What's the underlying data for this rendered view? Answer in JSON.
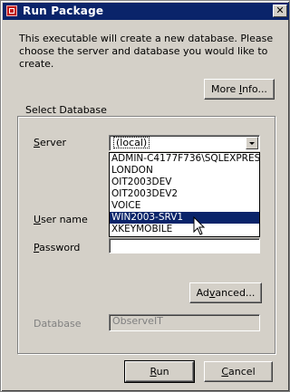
{
  "window": {
    "title": "Run Package",
    "close_glyph": "✕"
  },
  "intro_text": "This executable will create a new database. Please choose the server and database you would like to create.",
  "more_info_button": {
    "label_prefix": "More ",
    "label_mnemonic": "I",
    "label_suffix": "nfo..."
  },
  "group": {
    "title": "Select Database",
    "server": {
      "label_mnemonic": "S",
      "label_rest": "erver",
      "selected_value": "(local)",
      "options": [
        "ADMIN-C4177F736\\SQLEXPRESS",
        "LONDON",
        "OIT2003DEV",
        "OIT2003DEV2",
        "VOICE",
        "WIN2003-SRV1",
        "XKEYMOBILE"
      ],
      "highlighted_option": "WIN2003-SRV1"
    },
    "user_name": {
      "label_mnemonic": "U",
      "label_rest": "ser name",
      "value": ""
    },
    "password": {
      "label_mnemonic": "P",
      "label_rest": "assword",
      "value": ""
    },
    "advanced_button": {
      "label_prefix": "Ad",
      "label_mnemonic": "v",
      "label_suffix": "anced..."
    },
    "database": {
      "label": "Database",
      "value": "ObserveIT",
      "disabled": true
    }
  },
  "footer": {
    "run_button": {
      "label_mnemonic": "R",
      "label_rest": "un"
    },
    "cancel_button": {
      "label_mnemonic": "C",
      "label_rest": "ancel"
    }
  },
  "colors": {
    "titlebar": "#0a246a",
    "face": "#d4d0c8",
    "highlight": "#0a246a",
    "disabled_text": "#808080"
  },
  "icons": {
    "app": "package-icon",
    "close": "close-icon",
    "dropdown": "chevron-down-icon",
    "cursor": "mouse-pointer-icon"
  }
}
